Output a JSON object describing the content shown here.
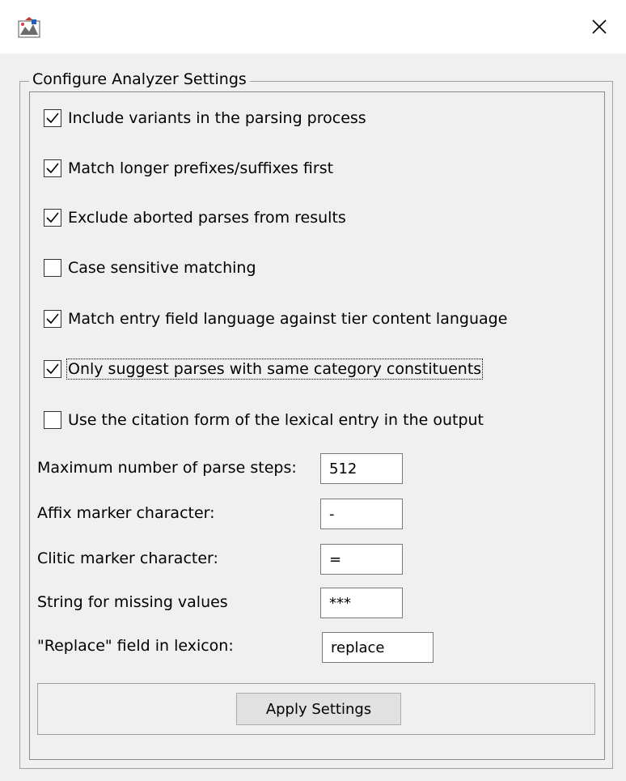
{
  "window": {
    "app_icon": "app-icon",
    "close_icon": "close-icon",
    "close_glyph": "✕"
  },
  "group": {
    "title": "Configure Analyzer Settings"
  },
  "options": [
    {
      "label": "Include variants in the parsing process",
      "checked": true
    },
    {
      "label": "Match longer prefixes/suffixes first",
      "checked": true
    },
    {
      "label": "Exclude aborted parses from results",
      "checked": true
    },
    {
      "label": "Case sensitive matching",
      "checked": false
    },
    {
      "label": "Match entry field language against tier content language",
      "checked": true
    },
    {
      "label": "Only suggest parses with same category constituents",
      "checked": true,
      "focused": true
    },
    {
      "label": "Use the citation form of the lexical entry in the output",
      "checked": false
    }
  ],
  "fields": {
    "max_parse_steps": {
      "label": "Maximum number of parse steps:",
      "value": "512"
    },
    "affix_marker": {
      "label": "Affix marker character:",
      "value": "-"
    },
    "clitic_marker": {
      "label": "Clitic marker character:",
      "value": "="
    },
    "missing_values": {
      "label": "String for missing values",
      "value": "***"
    },
    "replace_field": {
      "label": "\"Replace\" field in lexicon:",
      "value": "replace"
    }
  },
  "buttons": {
    "apply": "Apply Settings"
  },
  "colors": {
    "window_bg": "#f0f0f0",
    "titlebar_bg": "#ffffff",
    "button_bg": "#e1e1e1"
  }
}
